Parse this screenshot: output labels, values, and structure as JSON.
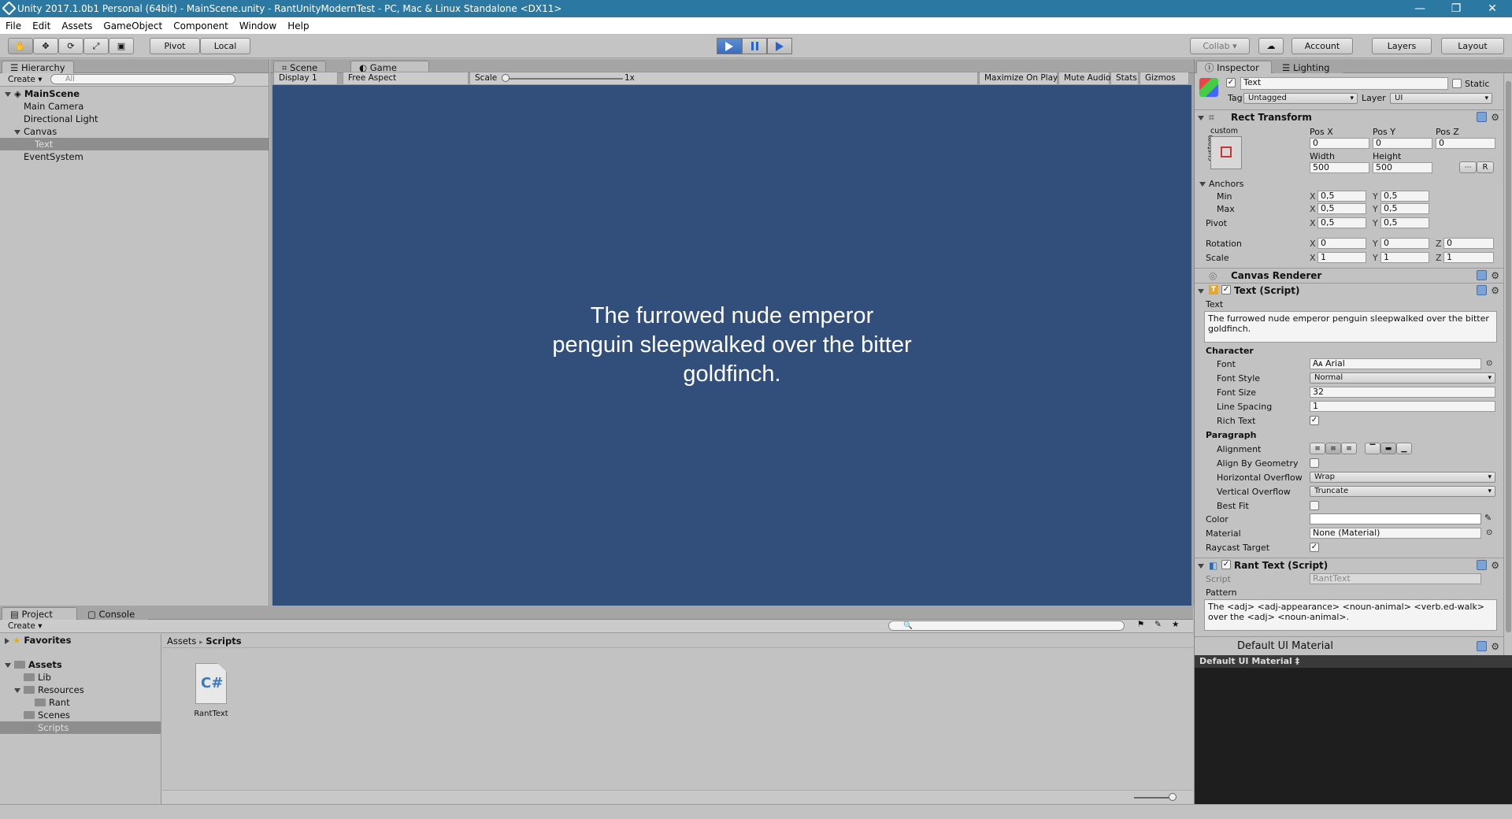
{
  "window": {
    "title": "Unity 2017.1.0b1 Personal (64bit) - MainScene.unity - RantUnityModernTest - PC, Mac & Linux Standalone <DX11>",
    "minimize": "—",
    "restore": "❐",
    "close": "✕"
  },
  "menu": [
    "File",
    "Edit",
    "Assets",
    "GameObject",
    "Component",
    "Window",
    "Help"
  ],
  "toolbar": {
    "pivot": "Pivot",
    "local": "Local",
    "collab": "Collab ▾",
    "account": "Account",
    "layers": "Layers",
    "layout": "Layout"
  },
  "hierarchy": {
    "tab": "Hierarchy",
    "create": "Create ▾",
    "search_placeholder": "All",
    "scene": "MainScene",
    "items": [
      "Main Camera",
      "Directional Light",
      "Canvas",
      "Text",
      "EventSystem"
    ]
  },
  "game": {
    "tab_scene": "Scene",
    "tab_game": "Game",
    "display": "Display 1",
    "aspect": "Free Aspect",
    "scale_label": "Scale",
    "scale_value": "1x",
    "maximize": "Maximize On Play",
    "mute": "Mute Audio",
    "stats": "Stats",
    "gizmos": "Gizmos",
    "text": "The furrowed nude emperor penguin sleepwalked over the bitter goldfinch."
  },
  "inspector": {
    "tab": "Inspector",
    "tab_lighting": "Lighting",
    "object_name": "Text",
    "static": "Static",
    "tag_label": "Tag",
    "tag": "Untagged",
    "layer_label": "Layer",
    "layer": "UI",
    "rect": {
      "title": "Rect Transform",
      "custom": "custom",
      "posx_label": "Pos X",
      "posy_label": "Pos Y",
      "posz_label": "Pos Z",
      "posx": "0",
      "posy": "0",
      "posz": "0",
      "width_label": "Width",
      "height_label": "Height",
      "width": "500",
      "height": "500",
      "r_button": "R",
      "anchors": "Anchors",
      "min": "Min",
      "max": "Max",
      "pivot": "Pivot",
      "min_x": "0,5",
      "min_y": "0,5",
      "max_x": "0,5",
      "max_y": "0,5",
      "pivot_x": "0,5",
      "pivot_y": "0,5",
      "rotation": "Rotation",
      "rot_x": "0",
      "rot_y": "0",
      "rot_z": "0",
      "scale": "Scale",
      "scale_x": "1",
      "scale_y": "1",
      "scale_z": "1"
    },
    "canvas_renderer": "Canvas Renderer",
    "text_script": {
      "title": "Text (Script)",
      "text_label": "Text",
      "text": "The furrowed nude emperor penguin sleepwalked over the bitter goldfinch.",
      "character": "Character",
      "font_label": "Font",
      "font": "Arial",
      "font_style_label": "Font Style",
      "font_style": "Normal",
      "font_size_label": "Font Size",
      "font_size": "32",
      "line_spacing_label": "Line Spacing",
      "line_spacing": "1",
      "rich_text_label": "Rich Text",
      "paragraph": "Paragraph",
      "alignment_label": "Alignment",
      "align_geometry_label": "Align By Geometry",
      "h_overflow_label": "Horizontal Overflow",
      "h_overflow": "Wrap",
      "v_overflow_label": "Vertical Overflow",
      "v_overflow": "Truncate",
      "best_fit_label": "Best Fit",
      "color_label": "Color",
      "material_label": "Material",
      "material": "None (Material)",
      "raycast_label": "Raycast Target"
    },
    "rant_script": {
      "title": "Rant Text (Script)",
      "script_label": "Script",
      "script": "RantText",
      "pattern_label": "Pattern",
      "pattern": "The <adj> <adj-appearance> <noun-animal> <verb.ed-walk> over the <adj> <noun-animal>."
    },
    "default_material": "Default UI Material",
    "preview_title": "Default UI Material ‡"
  },
  "project": {
    "tab": "Project",
    "tab_console": "Console",
    "create": "Create ▾",
    "favorites": "Favorites",
    "assets": "Assets",
    "tree": [
      "Lib",
      "Resources",
      "Rant",
      "Scenes",
      "Scripts"
    ],
    "breadcrumb_root": "Assets",
    "breadcrumb_sep": "▸",
    "breadcrumb_current": "Scripts",
    "file_name": "RantText",
    "file_icon": "C#"
  }
}
